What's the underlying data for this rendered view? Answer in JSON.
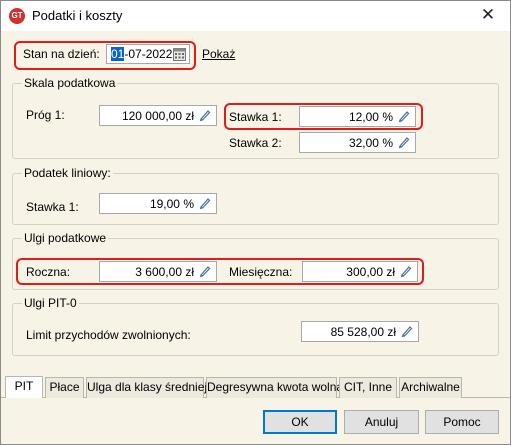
{
  "window": {
    "title": "Podatki i koszty",
    "app_icon_text": "GT"
  },
  "header": {
    "date_label": "Stan na dzień:",
    "date_day": "01",
    "date_rest": "-07-2022",
    "show_link": "Pokaż"
  },
  "tax_scale": {
    "legend": "Skala podatkowa",
    "threshold_label": "Próg 1:",
    "threshold_value": "120 000,00 zł",
    "rate1_label": "Stawka 1:",
    "rate1_value": "12,00 %",
    "rate2_label": "Stawka 2:",
    "rate2_value": "32,00 %"
  },
  "linear_tax": {
    "legend": "Podatek liniowy:",
    "rate1_label": "Stawka 1:",
    "rate1_value": "19,00 %"
  },
  "tax_relief": {
    "legend": "Ulgi podatkowe",
    "annual_label": "Roczna:",
    "annual_value": "3 600,00 zł",
    "monthly_label": "Miesięczna:",
    "monthly_value": "300,00 zł"
  },
  "pit0_relief": {
    "legend": "Ulgi PIT-0",
    "limit_label": "Limit przychodów zwolnionych:",
    "limit_value": "85 528,00 zł"
  },
  "tabs": [
    {
      "label": "PIT",
      "active": true
    },
    {
      "label": "Płace",
      "active": false
    },
    {
      "label": "Ulga dla klasy średniej",
      "active": false
    },
    {
      "label": "Degresywna kwota wolna",
      "active": false
    },
    {
      "label": "CIT, Inne",
      "active": false
    },
    {
      "label": "Archiwalne",
      "active": false
    }
  ],
  "buttons": {
    "ok": "OK",
    "cancel": "Anuluj",
    "help": "Pomoc"
  },
  "colors": {
    "highlight": "#e21b1b",
    "dialog_bg": "#f7f3e7",
    "selection": "#0a64c8"
  },
  "icons": {
    "edit": "pencil-icon",
    "calendar": "calendar-icon",
    "close": "close-icon"
  }
}
